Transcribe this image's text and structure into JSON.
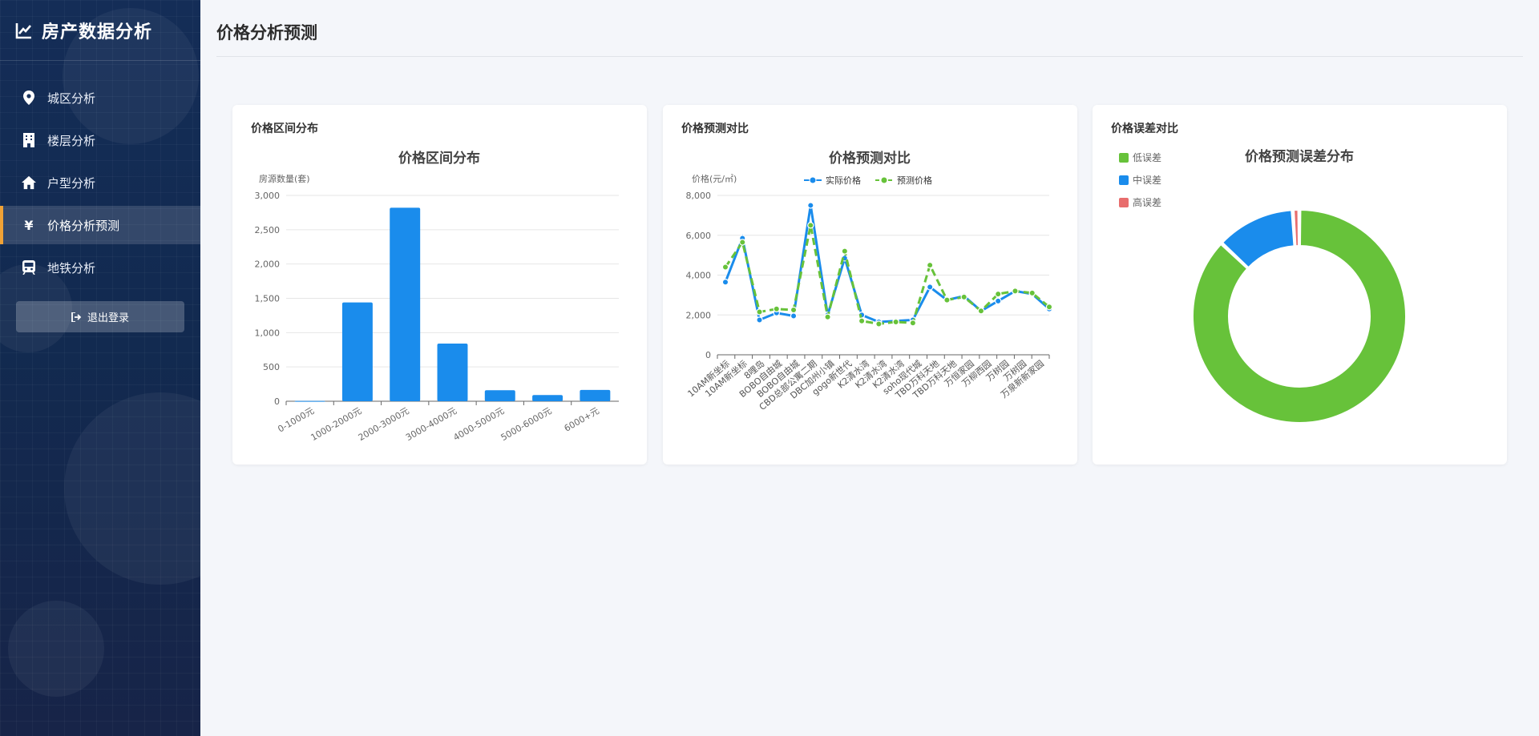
{
  "app": {
    "title": "房产数据分析",
    "brand_icon": "line-chart-icon"
  },
  "sidebar": {
    "items": [
      {
        "label": "城区分析",
        "icon": "map-marker-icon",
        "active": false
      },
      {
        "label": "楼层分析",
        "icon": "building-icon",
        "active": false
      },
      {
        "label": "户型分析",
        "icon": "home-icon",
        "active": false
      },
      {
        "label": "价格分析预测",
        "icon": "yen-icon",
        "active": true
      },
      {
        "label": "地铁分析",
        "icon": "subway-icon",
        "active": false
      }
    ],
    "logout_label": "退出登录"
  },
  "page": {
    "title": "价格分析预测"
  },
  "colors": {
    "accent": "#f0a236",
    "blue": "#1a8cec",
    "green": "#67c23a",
    "red": "#e86d6d"
  },
  "cards": {
    "distribution": {
      "title": "价格区间分布"
    },
    "prediction": {
      "title": "价格预测对比"
    },
    "error": {
      "title": "价格误差对比"
    }
  },
  "chart_data": [
    {
      "type": "bar",
      "title": "价格区间分布",
      "ylabel": "房源数量(套)",
      "xlabel": "",
      "categories": [
        "0-1000元",
        "1000-2000元",
        "2000-3000元",
        "3000-4000元",
        "4000-5000元",
        "5000-6000元",
        "6000+元"
      ],
      "values": [
        5,
        1440,
        2820,
        840,
        160,
        90,
        165
      ],
      "ylim": [
        0,
        3000
      ],
      "yticks": [
        "0",
        "500",
        "1,000",
        "1,500",
        "2,000",
        "2,500",
        "3,000"
      ],
      "grid": true,
      "color": "#1a8cec"
    },
    {
      "type": "line",
      "title": "价格预测对比",
      "ylabel": "价格(元/㎡)",
      "xlabel": "",
      "legend": "top-center",
      "categories": [
        "10AM新坐标",
        "10AM新坐标",
        "8哩岛",
        "BOBO自由城",
        "BOBO自由城",
        "CBD总部公寓二期",
        "DBC加州小镇",
        "gogo新世代",
        "K2清水湾",
        "K2清水湾",
        "K2清水湾",
        "soho现代城",
        "TBD万科天地",
        "TBD万科天地",
        "万恒家园",
        "万柳西园",
        "万树园",
        "万树园",
        "万泉新新家园"
      ],
      "ylim": [
        0,
        8000
      ],
      "yticks": [
        "0",
        "2,000",
        "4,000",
        "6,000",
        "8,000"
      ],
      "grid": true,
      "series": [
        {
          "name": "实际价格",
          "color": "#1a8cec",
          "values": [
            3650,
            5850,
            1750,
            2100,
            1950,
            7500,
            2000,
            4850,
            2000,
            1650,
            1700,
            1750,
            3400,
            2750,
            2950,
            2200,
            2700,
            3200,
            3050,
            2300
          ]
        },
        {
          "name": "预测价格",
          "color": "#67c23a",
          "values": [
            4400,
            5650,
            2150,
            2300,
            2250,
            6500,
            1900,
            5200,
            1700,
            1550,
            1650,
            1600,
            4500,
            2750,
            2900,
            2200,
            3050,
            3200,
            3100,
            2400
          ]
        }
      ]
    },
    {
      "type": "pie",
      "title": "价格预测误差分布",
      "legend": "top-left",
      "labels": [
        "低误差",
        "中误差",
        "高误差"
      ],
      "values": [
        87,
        12,
        1
      ],
      "colors": [
        "#67c23a",
        "#1a8cec",
        "#e86d6d"
      ]
    }
  ]
}
